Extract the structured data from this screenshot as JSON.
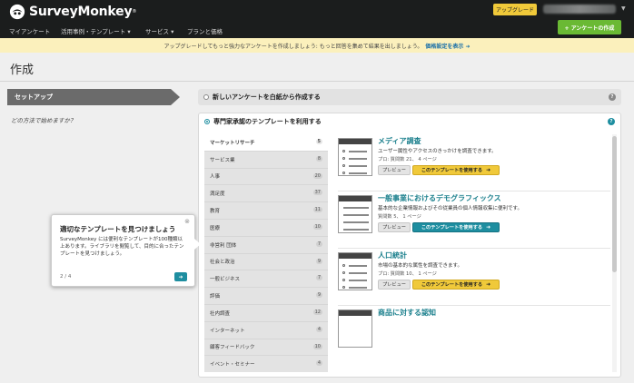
{
  "header": {
    "logo_text": "SurveyMonkey",
    "logo_mark": "®",
    "upgrade_label": "アップグレード",
    "create_survey_label": "+ アンケートの作成"
  },
  "nav": {
    "items": [
      "マイアンケート",
      "活用事例・テンプレート ▾",
      "サービス ▾",
      "プランと価格"
    ]
  },
  "promo": {
    "text": "アップグレードしてもっと強力なアンケートを作成しましょう: もっと回答を集めて結果を出しましょう。",
    "link": "価格設定を表示 ➜"
  },
  "page": {
    "title": "作成",
    "setup_tab": "セットアップ",
    "start_question": "どの方法で始めますか？"
  },
  "blank_panel": {
    "label": "新しいアンケートを白紙から作成する",
    "help": "?"
  },
  "expert_panel": {
    "label": "専門家承認のテンプレートを利用する",
    "help": "?"
  },
  "categories": [
    {
      "label": "マーケットリサーチ",
      "count": "5"
    },
    {
      "label": "サービス業",
      "count": "8"
    },
    {
      "label": "人事",
      "count": "20"
    },
    {
      "label": "満足度",
      "count": "37"
    },
    {
      "label": "教育",
      "count": "11"
    },
    {
      "label": "医療",
      "count": "10"
    },
    {
      "label": "非営利 団体",
      "count": "7"
    },
    {
      "label": "社会と政治",
      "count": "9"
    },
    {
      "label": "一般ビジネス",
      "count": "7"
    },
    {
      "label": "評価",
      "count": "9"
    },
    {
      "label": "社内調査",
      "count": "12"
    },
    {
      "label": "インターネット",
      "count": "4"
    },
    {
      "label": "顧客フィードバック",
      "count": "10"
    },
    {
      "label": "イベント・セミナー",
      "count": "4"
    }
  ],
  "templates": [
    {
      "title": "メディア調査",
      "desc": "ユーザー属性やアクセスのきっかけを調査できます。",
      "meta": "プロ: 質問数 21、 4 ページ",
      "preview": "プレビュー",
      "use": "このテンプレートを使用する"
    },
    {
      "title": "一般事業におけるデモグラフィックス",
      "desc": "基本的な企業情報およびその従業員の個人情報収集に便利です。",
      "meta": "質問数 5、 1 ページ",
      "preview": "プレビュー",
      "use": "このテンプレートを使用する"
    },
    {
      "title": "人口統計",
      "desc": "市場の基本的な属性を調査できます。",
      "meta": "プロ: 質問数 10、 1 ページ",
      "preview": "プレビュー",
      "use": "このテンプレートを使用する"
    },
    {
      "title": "商品に対する認知"
    }
  ],
  "tooltip": {
    "close": "⊗",
    "title": "適切なテンプレートを見つけましょう",
    "body": "SurveyMonkey には便利なテンプレートが100種類以上あります。ライブラリを閲覧して、目的に合ったテンプレートを見つけましょう。",
    "page": "2 / 4",
    "next": "➜"
  },
  "colors": {
    "header_bg": "#1b1d1d",
    "accent_green": "#6ab934",
    "accent_teal": "#1e8ea0",
    "accent_yellow": "#f0c93a",
    "promo_bg": "#fbf0bc"
  }
}
